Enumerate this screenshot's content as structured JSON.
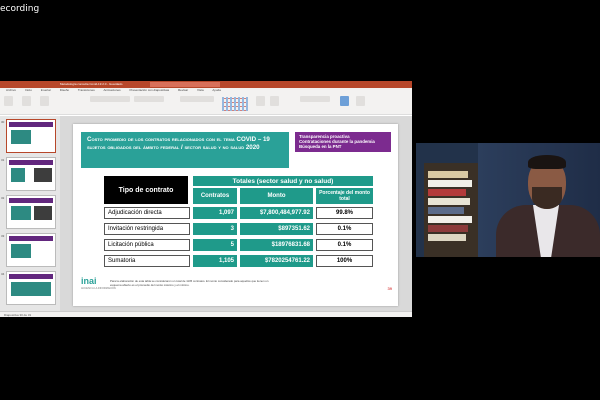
{
  "recording": {
    "label": "ecording"
  },
  "app": {
    "window_title": "Metodología consulta Covid-19 2.0 - Guardado",
    "tabs": [
      "Archivo",
      "Inicio",
      "Insertar",
      "Diseño",
      "Transiciones",
      "Animaciones",
      "Presentación con diapositivas",
      "Revisar",
      "Vista",
      "Ayuda"
    ],
    "status_text": "Diapositiva 30 de 31"
  },
  "thumbnails": [
    {
      "num": "30"
    },
    {
      "num": "31"
    },
    {
      "num": "32"
    },
    {
      "num": "33"
    },
    {
      "num": "34"
    }
  ],
  "slide": {
    "title": "Costo promedio de los contratos relacionados con el tema COVID – 19 sujetos obligados del ámbito federal / sector salud y no salud 2020",
    "side_box_lines": [
      "Transparencia proactiva",
      "Contrataciones durante la pandemia",
      "Búsqueda en la PNT"
    ],
    "table": {
      "type_header": "Tipo de contrato",
      "group_header": "Totales (sector salud y no salud)",
      "col_headers": [
        "Contratos",
        "Monto",
        "Porcentaje del monto total"
      ],
      "rows": [
        {
          "label": "Adjudicación directa",
          "contratos": "1,097",
          "monto": "$7,800,484,977.92",
          "pct": "99.8%"
        },
        {
          "label": "Invitación restringida",
          "contratos": "3",
          "monto": "$897351.62",
          "pct": "0.1%"
        },
        {
          "label": "Licitación pública",
          "contratos": "5",
          "monto": "$18976831.68",
          "pct": "0.1%"
        },
        {
          "label": "Sumatoria",
          "contratos": "1,105",
          "monto": "$7820254761.22",
          "pct": "100%"
        }
      ]
    },
    "footnote": "Para la elaboración de esta tabla se consideraron un total de 1105 contratos. El monto considerado para aquellos que tienen un esquema abierto es el promedio del monto máximo y el mínimo.",
    "logo_main": "inai",
    "logo_sub": "ACCESO A LA INFORMACIÓN",
    "slide_number": "39"
  },
  "colors": {
    "teal": "#1f9a8a",
    "purple": "#7c2b8f",
    "ppt_red": "#b7472a"
  }
}
